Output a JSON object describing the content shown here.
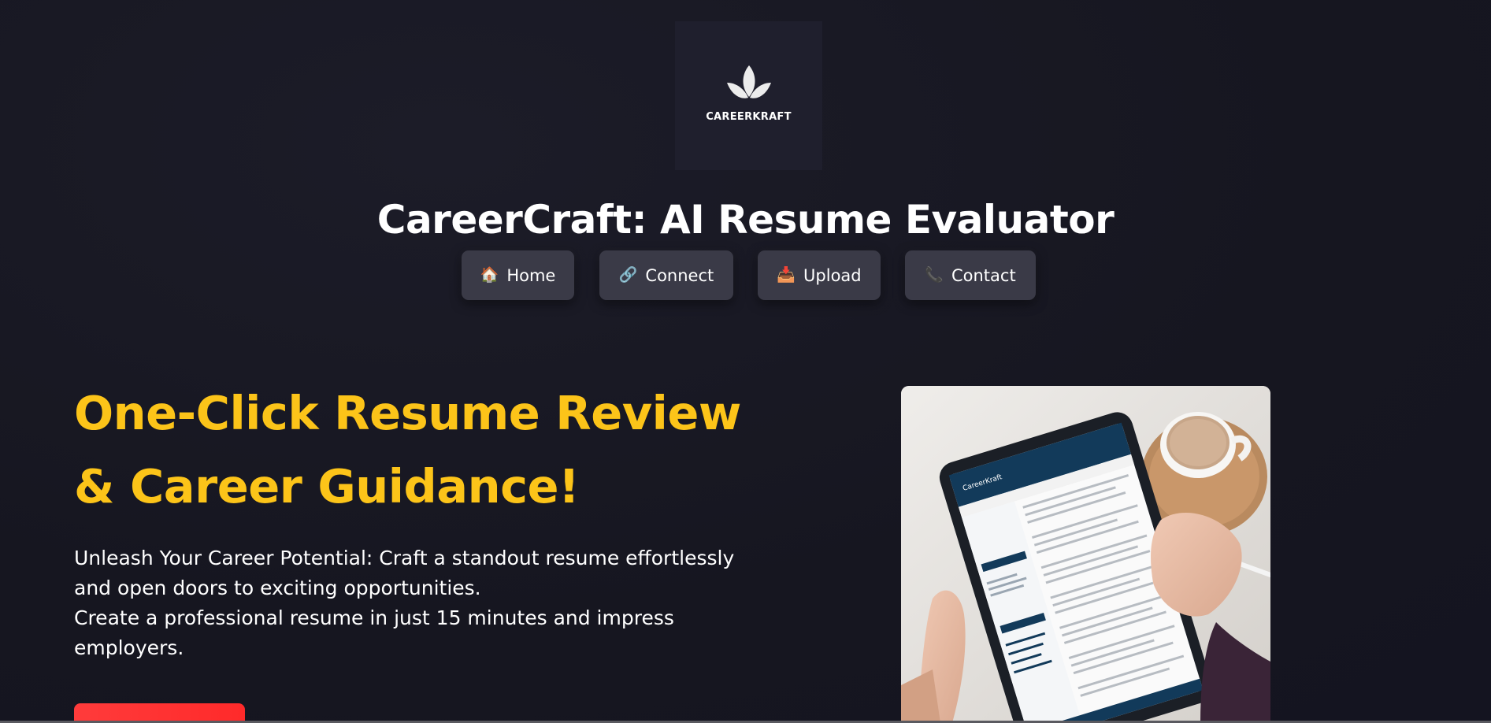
{
  "brand": {
    "logo_text": "CAREERKRAFT",
    "site_title": "CareerCraft: AI Resume Evaluator"
  },
  "nav": {
    "items": [
      {
        "icon": "house-icon",
        "glyph": "🏠",
        "label": "Home"
      },
      {
        "icon": "link-icon",
        "glyph": "🔗",
        "label": "Connect"
      },
      {
        "icon": "inbox-tray-icon",
        "glyph": "📥",
        "label": "Upload"
      },
      {
        "icon": "telephone-icon",
        "glyph": "📞",
        "label": "Contact"
      }
    ]
  },
  "hero": {
    "heading_line1": "One-Click Resume Review",
    "heading_line2": "& Career Guidance!",
    "text_line1": "Unleash Your Career Potential: Craft a standout resume effortlessly",
    "text_line2": "and open doors to exciting opportunities.",
    "text_line3": "Create a professional resume in just 15 minutes and impress",
    "text_line4": "employers.",
    "cta_label": "",
    "image_screen_brand": "CareerKraft"
  },
  "colors": {
    "background": "#171722",
    "accent_yellow": "#fcc419",
    "nav_button_bg": "#3a3a47",
    "cta_red": "#ff3333",
    "logo_box_bg": "#1f1f2d"
  }
}
